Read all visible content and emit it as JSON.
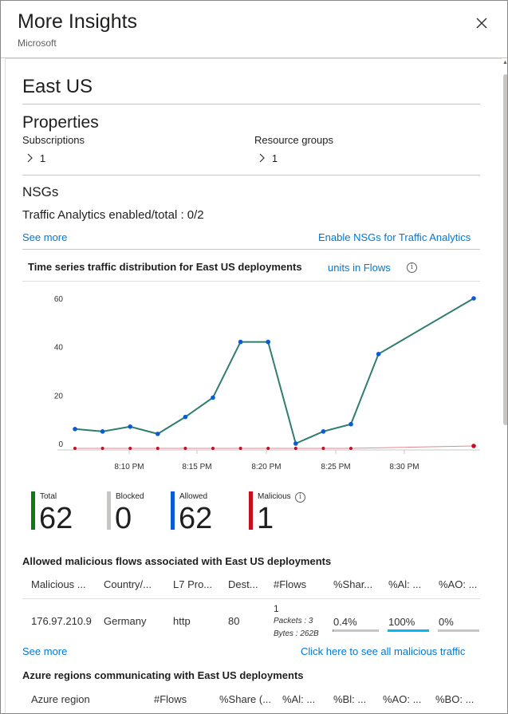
{
  "header": {
    "title": "More Insights",
    "subtitle": "Microsoft",
    "close_icon": "close-icon"
  },
  "region": {
    "name": "East US"
  },
  "properties": {
    "heading": "Properties",
    "subscriptions_label": "Subscriptions",
    "subscriptions_count": "1",
    "resource_groups_label": "Resource groups",
    "resource_groups_count": "1"
  },
  "nsgs": {
    "heading": "NSGs",
    "traffic_analytics_text": "Traffic Analytics enabled/total : 0/2",
    "see_more": "See more",
    "enable_link": "Enable NSGs for Traffic Analytics"
  },
  "chart_section": {
    "title": "Time series traffic distribution for East US deployments",
    "units_link": "units in Flows",
    "info_icon": "info-icon"
  },
  "chart_data": {
    "type": "line",
    "title": "",
    "xlabel": "",
    "ylabel": "",
    "x_tick_labels": [
      "8:10 PM",
      "8:15 PM",
      "8:20 PM",
      "8:25 PM",
      "8:30 PM"
    ],
    "y_tick_labels": [
      "0",
      "20",
      "40",
      "60"
    ],
    "ylim": [
      0,
      60
    ],
    "x_minutes": [
      0,
      5,
      10,
      15,
      20,
      25,
      30,
      35,
      40,
      45,
      50,
      55,
      60,
      65,
      80
    ],
    "series": [
      {
        "name": "Allowed",
        "color": "#0a5bd7",
        "line_color": "#2e7d6f",
        "values": [
          6,
          5,
          7,
          4,
          11,
          19,
          42,
          42,
          0,
          5,
          8,
          37,
          60
        ],
        "x_index": [
          0,
          1,
          2,
          3,
          4,
          5,
          6,
          7,
          8,
          9,
          10,
          11,
          12
        ]
      },
      {
        "name": "Malicious",
        "color": "#c50f1f",
        "values": [
          0,
          0,
          0,
          0,
          0,
          0,
          0,
          0,
          0,
          0,
          0,
          1
        ],
        "x_index": [
          0,
          1,
          2,
          3,
          4,
          5,
          6,
          7,
          8,
          9,
          10,
          12
        ]
      }
    ],
    "grid": false,
    "legend": "none"
  },
  "stats": [
    {
      "label": "Total",
      "value": "62",
      "color": "#107c10"
    },
    {
      "label": "Blocked",
      "value": "0",
      "color": "#c8c6c4"
    },
    {
      "label": "Allowed",
      "value": "62",
      "color": "#0a5bd7"
    },
    {
      "label": "Malicious",
      "value": "1",
      "color": "#c50f1f"
    }
  ],
  "malicious_table": {
    "title": "Allowed malicious flows associated with East US deployments",
    "headers": [
      "Malicious ...",
      "Country/...",
      "L7 Pro...",
      "Dest...",
      "#Flows",
      "%Shar...",
      "%Al: ...",
      "%AO: ..."
    ],
    "row": {
      "ip": "176.97.210.9",
      "country": "Germany",
      "protocol": "http",
      "dest_port": "80",
      "flows": "1",
      "packets": "Packets : 3",
      "bytes": "Bytes : 262B",
      "share": "0.4%",
      "share_frac": 0.004,
      "al": "100%",
      "al_frac": 1.0,
      "ao": "0%",
      "ao_frac": 0.0,
      "bar_color": "#00b7f1"
    },
    "see_more": "See more",
    "all_malicious_link": "Click here to see all malicious traffic"
  },
  "regions_table": {
    "title": "Azure regions communicating with East US deployments",
    "headers": [
      "Azure region",
      "#Flows",
      "%Share (...",
      "%Al: ...",
      "%Bl: ...",
      "%AO: ...",
      "%BO: ..."
    ]
  }
}
